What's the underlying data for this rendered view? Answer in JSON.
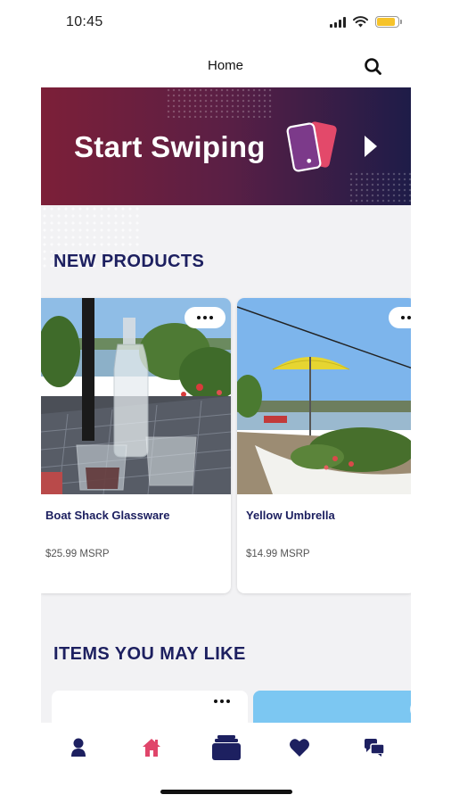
{
  "status_bar": {
    "time": "10:45",
    "battery_level": 0.85
  },
  "header": {
    "title": "Home",
    "search_icon": "search-icon"
  },
  "banner": {
    "title": "Start Swiping",
    "icon": "phone-cards-icon",
    "arrow_icon": "play-arrow-icon"
  },
  "sections": {
    "new_products": "NEW PRODUCTS",
    "items_you_may_like": "ITEMS YOU MAY LIKE"
  },
  "products": [
    {
      "name": "Boat Shack Glassware",
      "price": "$25.99 MSRP",
      "image": "glassware-photo"
    },
    {
      "name": "Yellow Umbrella",
      "price": "$14.99 MSRP",
      "image": "umbrella-photo"
    }
  ],
  "tab_bar": {
    "tabs": [
      {
        "icon": "profile-icon",
        "active": false
      },
      {
        "icon": "home-icon",
        "active": true
      },
      {
        "icon": "card-stack-icon",
        "active": false
      },
      {
        "icon": "heart-icon",
        "active": false
      },
      {
        "icon": "chat-icon",
        "active": false
      }
    ]
  },
  "colors": {
    "navy": "#1d2060",
    "accent_pink": "#e0456a",
    "banner_start": "#7c1f38",
    "banner_end": "#1e1c48"
  }
}
